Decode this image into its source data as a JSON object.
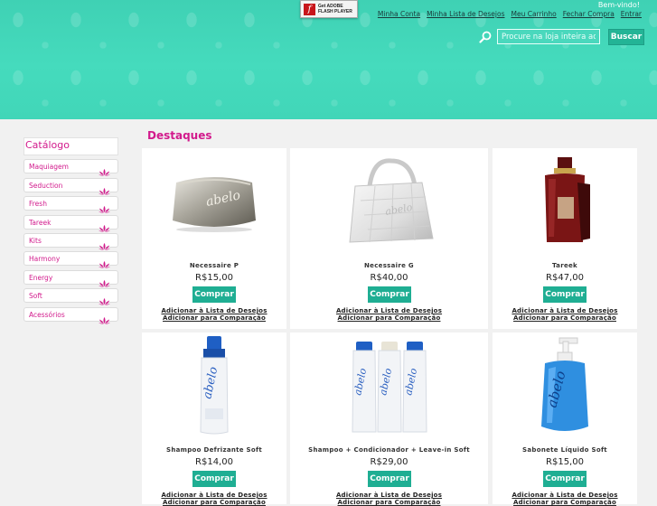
{
  "header": {
    "flash_badge": {
      "line1": "Get ADOBE",
      "line2": "FLASH PLAYER",
      "icon": "flash-player-icon"
    },
    "welcome": "Bem-vindo!",
    "links": [
      "Minha Conta",
      "Minha Lista de Desejos",
      "Meu Carrinho",
      "Fechar Compra",
      "Entrar"
    ],
    "search": {
      "placeholder": "Procure na loja inteira aqui...",
      "button": "Buscar",
      "icon": "search-icon"
    },
    "colors": {
      "background": "#41d6b8",
      "accent": "#d21a8c",
      "button": "#1fae93"
    }
  },
  "sidebar": {
    "title": "Catálogo",
    "items": [
      "Maquiagem",
      "Seduction",
      "Fresh",
      "Tareek",
      "Kits",
      "Harmony",
      "Energy",
      "Soft",
      "Acessórios"
    ],
    "item_icon": "lotus-icon"
  },
  "main": {
    "title": "Destaques",
    "buy_label": "Comprar",
    "wishlist_label": "Adicionar à Lista de Desejos",
    "compare_label": "Adicionar para Comparação",
    "products": [
      {
        "name": "Necessaire P",
        "price": "R$15,00",
        "image": "pouch-image"
      },
      {
        "name": "Necessaire G",
        "price": "R$40,00",
        "image": "bag-image"
      },
      {
        "name": "Tareek",
        "price": "R$47,00",
        "image": "perfume-image"
      },
      {
        "name": "Shampoo Defrizante Soft",
        "price": "R$14,00",
        "image": "shampoo-bottle-image"
      },
      {
        "name": "Shampoo + Condicionador + Leave-in Soft",
        "price": "R$29,00",
        "image": "three-bottles-image"
      },
      {
        "name": "Sabonete Líquido Soft",
        "price": "R$15,00",
        "image": "soap-pump-image"
      }
    ]
  }
}
